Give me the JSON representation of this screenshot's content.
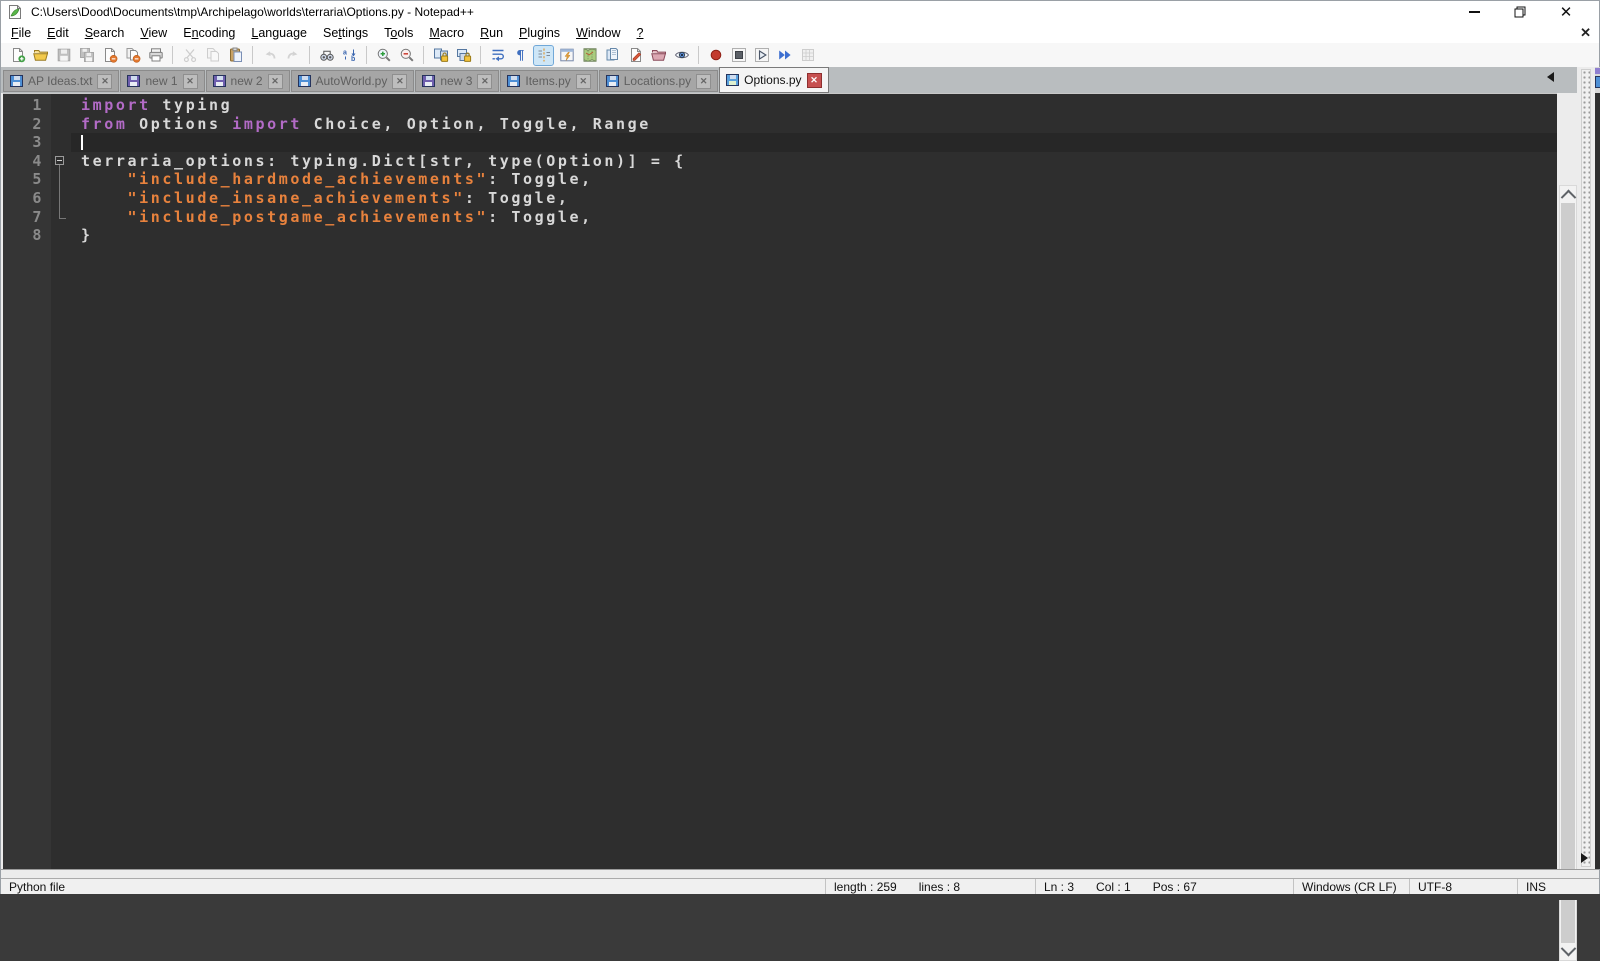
{
  "window": {
    "title": "C:\\Users\\Dood\\Documents\\tmp\\Archipelago\\worlds\\terraria\\Options.py - Notepad++"
  },
  "menu_bar": {
    "items": [
      {
        "label": "File",
        "accel": 0
      },
      {
        "label": "Edit",
        "accel": 0
      },
      {
        "label": "Search",
        "accel": 0
      },
      {
        "label": "View",
        "accel": 0
      },
      {
        "label": "Encoding",
        "accel": 1
      },
      {
        "label": "Language",
        "accel": 0
      },
      {
        "label": "Settings",
        "accel": 2
      },
      {
        "label": "Tools",
        "accel": 1
      },
      {
        "label": "Macro",
        "accel": 0
      },
      {
        "label": "Run",
        "accel": 0
      },
      {
        "label": "Plugins",
        "accel": 0
      },
      {
        "label": "Window",
        "accel": 0
      },
      {
        "label": "?",
        "accel": 0
      }
    ]
  },
  "toolbar": {
    "groups": [
      [
        {
          "name": "new-file"
        },
        {
          "name": "open-file"
        },
        {
          "name": "save-file",
          "disabled": true
        },
        {
          "name": "save-all",
          "disabled": true
        },
        {
          "name": "close-file"
        },
        {
          "name": "close-all"
        },
        {
          "name": "print"
        }
      ],
      [
        {
          "name": "cut",
          "disabled": true
        },
        {
          "name": "copy",
          "disabled": true
        },
        {
          "name": "paste"
        }
      ],
      [
        {
          "name": "undo",
          "disabled": true
        },
        {
          "name": "redo",
          "disabled": true
        }
      ],
      [
        {
          "name": "find"
        },
        {
          "name": "replace"
        }
      ],
      [
        {
          "name": "zoom-in"
        },
        {
          "name": "zoom-out"
        }
      ],
      [
        {
          "name": "sync-vertical-scroll"
        },
        {
          "name": "sync-horizontal-scroll"
        }
      ],
      [
        {
          "name": "word-wrap"
        },
        {
          "name": "show-all-characters"
        },
        {
          "name": "show-indent-guide",
          "active": true
        },
        {
          "name": "function-list"
        },
        {
          "name": "document-map"
        },
        {
          "name": "document-list"
        },
        {
          "name": "edit-shortcuts"
        },
        {
          "name": "folder-as-workspace"
        },
        {
          "name": "monitoring"
        }
      ],
      [
        {
          "name": "record-macro"
        },
        {
          "name": "stop-macro"
        },
        {
          "name": "playback-macro"
        },
        {
          "name": "run-macro-multiple"
        },
        {
          "name": "save-macro",
          "disabled": true
        }
      ]
    ]
  },
  "tab_bar": {
    "tabs": [
      {
        "label": "AP Ideas.txt",
        "state": "saved"
      },
      {
        "label": "new 1",
        "state": "modified"
      },
      {
        "label": "new 2",
        "state": "modified"
      },
      {
        "label": "AutoWorld.py",
        "state": "saved"
      },
      {
        "label": "new 3",
        "state": "modified"
      },
      {
        "label": "Items.py",
        "state": "saved"
      },
      {
        "label": "Locations.py",
        "state": "saved"
      },
      {
        "label": "Options.py",
        "state": "active"
      }
    ]
  },
  "editor": {
    "caret": {
      "line": 3,
      "col": 1
    },
    "lines": [
      {
        "num": "1",
        "fold": "",
        "current": false,
        "segments": [
          {
            "text": "import",
            "style": "keyword"
          },
          {
            "text": " typing",
            "style": "default"
          }
        ]
      },
      {
        "num": "2",
        "fold": "",
        "current": false,
        "segments": [
          {
            "text": "from",
            "style": "keyword"
          },
          {
            "text": " Options ",
            "style": "default"
          },
          {
            "text": "import",
            "style": "keyword"
          },
          {
            "text": " Choice, Option, Toggle, Range",
            "style": "default"
          }
        ]
      },
      {
        "num": "3",
        "fold": "",
        "current": true,
        "segments": []
      },
      {
        "num": "4",
        "fold": "open",
        "current": false,
        "segments": [
          {
            "text": "terraria_options: typing.Dict[str, type(Option)] = {",
            "style": "default"
          }
        ]
      },
      {
        "num": "5",
        "fold": "line",
        "current": false,
        "segments": [
          {
            "text": "    ",
            "style": "default"
          },
          {
            "text": "\"include_hardmode_achievements\"",
            "style": "string"
          },
          {
            "text": ": Toggle,",
            "style": "default"
          }
        ]
      },
      {
        "num": "6",
        "fold": "line",
        "current": false,
        "segments": [
          {
            "text": "    ",
            "style": "default"
          },
          {
            "text": "\"include_insane_achievements\"",
            "style": "string"
          },
          {
            "text": ": Toggle,",
            "style": "default"
          }
        ]
      },
      {
        "num": "7",
        "fold": "end",
        "current": false,
        "segments": [
          {
            "text": "    ",
            "style": "default"
          },
          {
            "text": "\"include_postgame_achievements\"",
            "style": "string"
          },
          {
            "text": ": Toggle,",
            "style": "default"
          }
        ]
      },
      {
        "num": "8",
        "fold": "",
        "current": false,
        "segments": [
          {
            "text": "}",
            "style": "default"
          }
        ]
      }
    ]
  },
  "status_bar": {
    "doc_type": "Python file",
    "length_label": "length : 259",
    "lines_label": "lines : 8",
    "ln_label": "Ln : 3",
    "col_label": "Col : 1",
    "pos_label": "Pos : 67",
    "eol": "Windows (CR LF)",
    "encoding": "UTF-8",
    "insert_mode": "INS"
  },
  "colors": {
    "keyword": "#b36bc7",
    "string": "#e8823d",
    "default_text": "#d8d8d8",
    "editor_bg": "#2e2e2e",
    "current_line_bg": "#272727",
    "gutter_text": "#8a8a8a",
    "active_tab_close": "#c75050"
  }
}
